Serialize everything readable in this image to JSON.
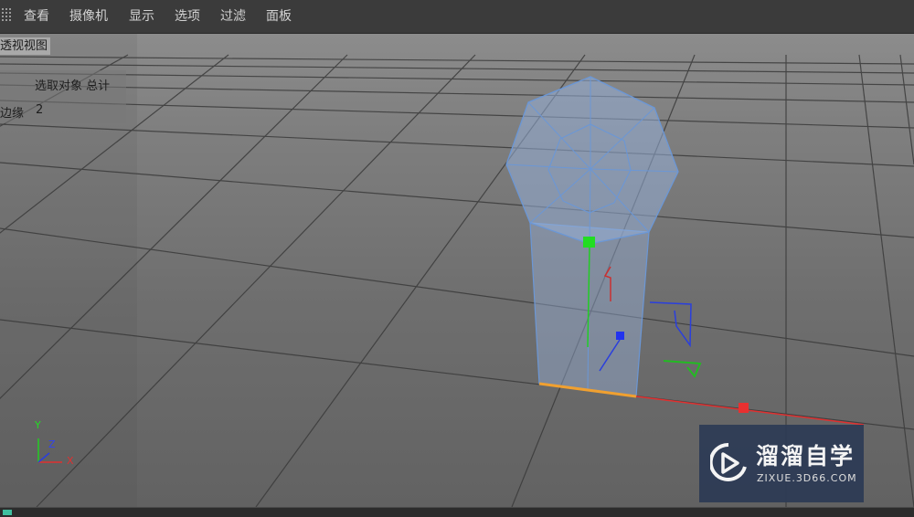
{
  "menubar": {
    "items": [
      "查看",
      "摄像机",
      "显示",
      "选项",
      "过滤",
      "面板"
    ]
  },
  "viewport": {
    "title": "透视视图",
    "hud": {
      "header": "选取对象 总计",
      "row_label": "边缘",
      "row_value": "2"
    },
    "axes": {
      "y": "Y",
      "z": "Z",
      "x": "X"
    }
  },
  "watermark": {
    "name": "溜溜自学",
    "url": "ZIXUE.3D66.COM"
  },
  "colors": {
    "menubar_bg": "#3b3b3b",
    "mesh_line": "#6b97d6",
    "axis_x": "#e03030",
    "axis_y": "#22cc22",
    "axis_z": "#2a3fdd",
    "selected_edge": "#f0a030",
    "watermark_bg": "#2d3b55"
  }
}
